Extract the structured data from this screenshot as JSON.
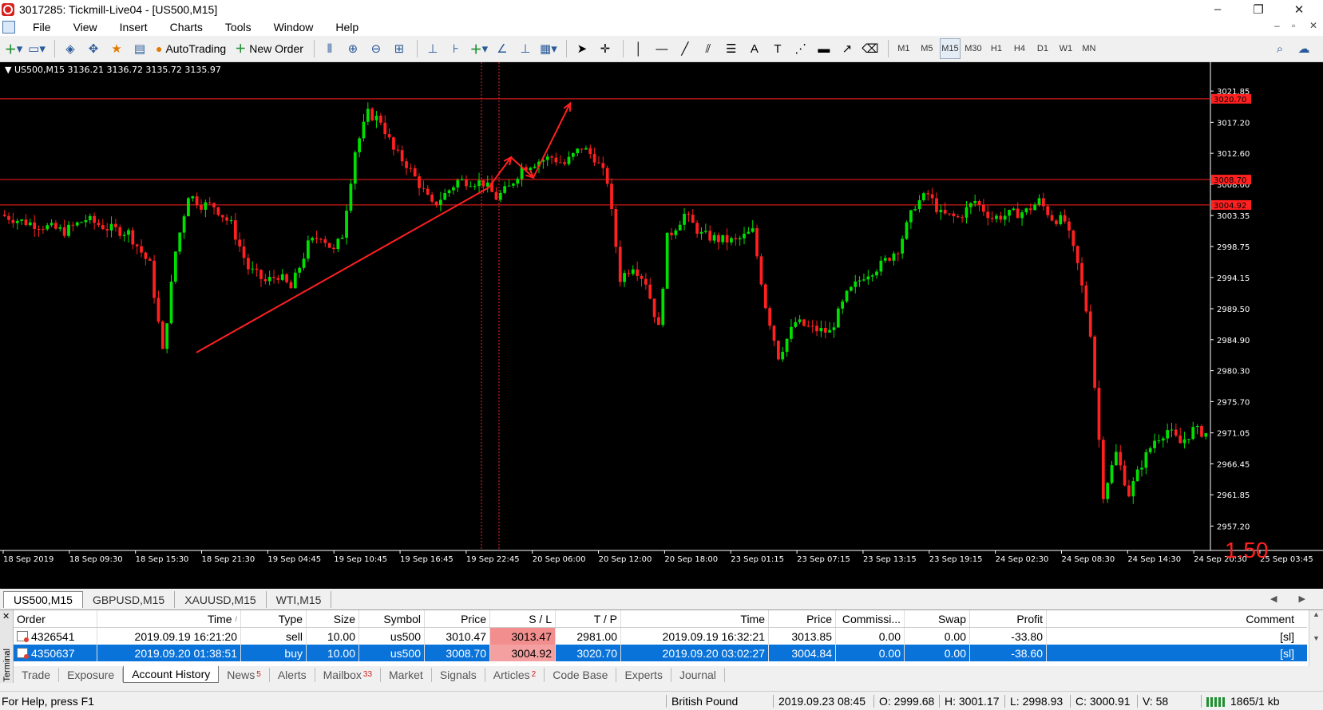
{
  "window": {
    "title": "3017285: Tickmill-Live04 - [US500,M15]",
    "minimize": "–",
    "restore": "❐",
    "close": "✕"
  },
  "menu": {
    "items": [
      "File",
      "View",
      "Insert",
      "Charts",
      "Tools",
      "Window",
      "Help"
    ],
    "mdi_min": "–",
    "mdi_restore": "▫",
    "mdi_close": "✕"
  },
  "toolbar": {
    "autotrading_label": "AutoTrading",
    "neworder_label": "New Order",
    "timeframes": [
      "M1",
      "M5",
      "M15",
      "M30",
      "H1",
      "H4",
      "D1",
      "W1",
      "MN"
    ],
    "active_timeframe": "M15"
  },
  "chart": {
    "info": "▼ US500,M15  3136.21 3136.72 3135.72 3135.97",
    "big_number": "1.50",
    "colors": {
      "background": "#000000",
      "bull": "#00e000",
      "bear": "#ff2020",
      "line": "#ff2020",
      "axis": "#ffffff"
    }
  },
  "chart_data": {
    "type": "candlestick",
    "symbol": "US500",
    "timeframe": "M15",
    "ylim": [
      2955.0,
      3024.0
    ],
    "y_ticks": [
      3021.85,
      3017.2,
      3012.6,
      3008.0,
      3003.35,
      2998.75,
      2994.15,
      2989.5,
      2984.9,
      2980.3,
      2975.7,
      2971.05,
      2966.45,
      2961.85,
      2957.2
    ],
    "y_tick_labels": [
      "3021.85",
      "3017.20",
      "3012.60",
      "3008.00",
      "3003.35",
      "2998.75",
      "2994.15",
      "2989.50",
      "2984.90",
      "2980.30",
      "2975.70",
      "2971.05",
      "2966.45",
      "2961.85",
      "2957.20"
    ],
    "x_tick_labels": [
      "18 Sep 2019",
      "18 Sep 09:30",
      "18 Sep 15:30",
      "18 Sep 21:30",
      "19 Sep 04:45",
      "19 Sep 10:45",
      "19 Sep 16:45",
      "19 Sep 22:45",
      "20 Sep 06:00",
      "20 Sep 12:00",
      "20 Sep 18:00",
      "23 Sep 01:15",
      "23 Sep 07:15",
      "23 Sep 13:15",
      "23 Sep 19:15",
      "24 Sep 02:30",
      "24 Sep 08:30",
      "24 Sep 14:30",
      "24 Sep 20:30",
      "25 Sep 03:45"
    ],
    "horizontal_levels": [
      {
        "value": 3020.7,
        "label": "3020.70"
      },
      {
        "value": 3008.7,
        "label": "3008.70"
      },
      {
        "value": 3004.92,
        "label": "3004.92"
      }
    ],
    "price_path": [
      [
        0,
        3003.5
      ],
      [
        5,
        3002.5
      ],
      [
        10,
        3001.8
      ],
      [
        15,
        3001.0
      ],
      [
        20,
        3002.8
      ],
      [
        25,
        3001.5
      ],
      [
        30,
        3000.8
      ],
      [
        35,
        2996.0
      ],
      [
        38,
        2983.0
      ],
      [
        41,
        2998.0
      ],
      [
        44,
        3006.5
      ],
      [
        47,
        3005.0
      ],
      [
        50,
        3004.8
      ],
      [
        54,
        3002.0
      ],
      [
        58,
        2995.5
      ],
      [
        62,
        2993.5
      ],
      [
        65,
        2994.5
      ],
      [
        68,
        2992.5
      ],
      [
        72,
        2999.0
      ],
      [
        75,
        3000.5
      ],
      [
        78,
        2998.0
      ],
      [
        80,
        3000.5
      ],
      [
        83,
        3013.0
      ],
      [
        86,
        3018.5
      ],
      [
        89,
        3017.5
      ],
      [
        92,
        3013.0
      ],
      [
        95,
        3011.0
      ],
      [
        98,
        3008.0
      ],
      [
        101,
        3004.8
      ],
      [
        104,
        3006.5
      ],
      [
        107,
        3008.5
      ],
      [
        110,
        3008.5
      ],
      [
        113,
        3008.2
      ],
      [
        116,
        3006.0
      ],
      [
        119,
        3007.5
      ],
      [
        122,
        3010.5
      ],
      [
        126,
        3011.5
      ],
      [
        129,
        3012.0
      ],
      [
        132,
        3011.0
      ],
      [
        136,
        3013.5
      ],
      [
        139,
        3012.0
      ],
      [
        142,
        3008.5
      ],
      [
        145,
        2994.0
      ],
      [
        148,
        2996.0
      ],
      [
        151,
        2993.5
      ],
      [
        154,
        2986.5
      ],
      [
        156,
        3000.0
      ],
      [
        160,
        3003.5
      ],
      [
        164,
        3000.5
      ],
      [
        168,
        2999.8
      ],
      [
        172,
        2999.5
      ],
      [
        176,
        3001.0
      ],
      [
        179,
        2990.0
      ],
      [
        182,
        2982.5
      ],
      [
        186,
        2987.5
      ],
      [
        190,
        2986.5
      ],
      [
        194,
        2986.0
      ],
      [
        198,
        2991.5
      ],
      [
        202,
        2994.5
      ],
      [
        206,
        2996.0
      ],
      [
        210,
        2998.5
      ],
      [
        214,
        3005.0
      ],
      [
        217,
        3006.5
      ],
      [
        220,
        3003.5
      ],
      [
        224,
        3003.0
      ],
      [
        228,
        3005.5
      ],
      [
        232,
        3003.0
      ],
      [
        236,
        3003.5
      ],
      [
        240,
        3004.0
      ],
      [
        243,
        3005.5
      ],
      [
        246,
        3003.0
      ],
      [
        249,
        3002.5
      ],
      [
        252,
        2996.0
      ],
      [
        255,
        2986.0
      ],
      [
        258,
        2962.0
      ],
      [
        261,
        2968.0
      ],
      [
        264,
        2962.0
      ],
      [
        267,
        2966.5
      ],
      [
        270,
        2970.0
      ],
      [
        273,
        2971.5
      ],
      [
        276,
        2969.5
      ],
      [
        279,
        2971.5
      ],
      [
        282,
        2971.0
      ]
    ],
    "n_bars": 282,
    "drawn_trendline": {
      "from": [
        "18 Sep 21:30",
        2983.0
      ],
      "to": [
        "19 Sep 22:45",
        3007.5
      ]
    },
    "drawn_arrows": [
      [
        [
          "19 Sep 22:45",
          3007.5
        ],
        [
          "19 Sep 23:30",
          3012.0
        ]
      ],
      [
        "19 Sep 23:30",
        3012.0
      ],
      [
        "20 Sep 00:15",
        3009.0
      ],
      [
        [
          "20 Sep 00:15",
          3009.0
        ],
        [
          "20 Sep 02:00",
          3020.0
        ]
      ]
    ]
  },
  "chart_tabs": [
    "US500,M15",
    "GBPUSD,M15",
    "XAUUSD,M15",
    "WTI,M15"
  ],
  "chart_tab_arrows": "◀ ▶",
  "terminal": {
    "side_label": "Terminal",
    "close": "✕",
    "columns": [
      "Order",
      "Time",
      "Type",
      "Size",
      "Symbol",
      "Price",
      "S / L",
      "T / P",
      "Time",
      "Price",
      "Commissi...",
      "Swap",
      "Profit",
      "Comment"
    ],
    "sort_marker": "/",
    "rows": [
      {
        "order": "4326541",
        "open_time": "2019.09.19 16:21:20",
        "type": "sell",
        "size": "10.00",
        "symbol": "us500",
        "price": "3010.47",
        "sl": "3013.47",
        "tp": "2981.00",
        "close_time": "2019.09.19 16:32:21",
        "close_price": "3013.85",
        "commission": "0.00",
        "swap": "0.00",
        "profit": "-33.80",
        "comment": "[sl]"
      },
      {
        "order": "4350637",
        "open_time": "2019.09.20 01:38:51",
        "type": "buy",
        "size": "10.00",
        "symbol": "us500",
        "price": "3008.70",
        "sl": "3004.92",
        "tp": "3020.70",
        "close_time": "2019.09.20 03:02:27",
        "close_price": "3004.84",
        "commission": "0.00",
        "swap": "0.00",
        "profit": "-38.60",
        "comment": "[sl]"
      }
    ],
    "tabs": [
      {
        "label": "Trade"
      },
      {
        "label": "Exposure"
      },
      {
        "label": "Account History"
      },
      {
        "label": "News",
        "badge": "5"
      },
      {
        "label": "Alerts"
      },
      {
        "label": "Mailbox",
        "badge": "33"
      },
      {
        "label": "Market"
      },
      {
        "label": "Signals"
      },
      {
        "label": "Articles",
        "badge": "2"
      },
      {
        "label": "Code Base"
      },
      {
        "label": "Experts"
      },
      {
        "label": "Journal"
      }
    ],
    "active_tab": "Account History"
  },
  "status": {
    "help": "For Help, press F1",
    "profile": "British Pound",
    "datetime": "2019.09.23 08:45",
    "open": "O: 2999.68",
    "high": "H: 3001.17",
    "low": "L: 2998.93",
    "close": "C: 3000.91",
    "volume": "V: 58",
    "traffic": "1865/1 kb"
  }
}
